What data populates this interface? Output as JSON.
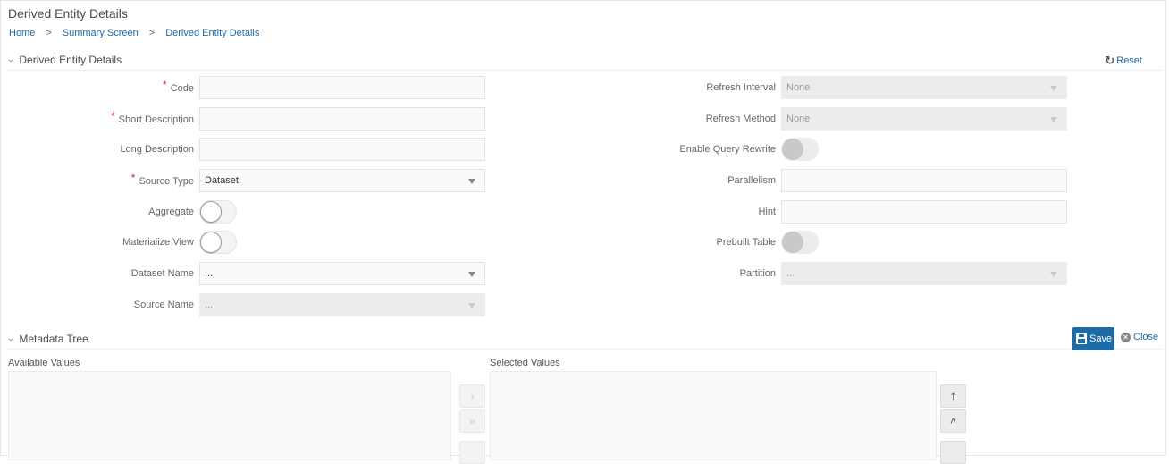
{
  "page": {
    "title": "Derived Entity Details",
    "breadcrumb": [
      "Home",
      "Summary Screen",
      "Derived Entity Details"
    ],
    "breadcrumb_separator": ">"
  },
  "details_section": {
    "title": "Derived Entity Details",
    "reset_label": "Reset",
    "left_fields": [
      {
        "label": "Code",
        "required": true,
        "type": "text",
        "value": ""
      },
      {
        "label": "Short Description",
        "required": true,
        "type": "text",
        "value": ""
      },
      {
        "label": "Long Description",
        "required": false,
        "type": "text",
        "value": ""
      },
      {
        "label": "Source Type",
        "required": true,
        "type": "select",
        "value": "Dataset"
      },
      {
        "label": "Aggregate",
        "required": false,
        "type": "toggle",
        "value": "off"
      },
      {
        "label": "Materialize View",
        "required": false,
        "type": "toggle",
        "value": "off"
      },
      {
        "label": "Dataset Name",
        "required": false,
        "type": "select",
        "value": "..."
      },
      {
        "label": "Source Name",
        "required": false,
        "type": "select",
        "value": "...",
        "disabled": true
      }
    ],
    "right_fields": [
      {
        "label": "Refresh Interval",
        "type": "select",
        "value": "None",
        "disabled": true
      },
      {
        "label": "Refresh Method",
        "type": "select",
        "value": "None",
        "disabled": true
      },
      {
        "label": "Enable Query Rewrite",
        "type": "toggle",
        "value": "off",
        "disabled": true
      },
      {
        "label": "Parallelism",
        "type": "text",
        "value": ""
      },
      {
        "label": "Hint",
        "type": "text",
        "value": ""
      },
      {
        "label": "Prebuilt Table",
        "type": "toggle",
        "value": "off",
        "disabled": true
      },
      {
        "label": "Partition",
        "type": "select",
        "value": "...",
        "disabled": true
      }
    ],
    "required_marker": "*"
  },
  "metadata_section": {
    "title": "Metadata Tree",
    "save_label": "Save",
    "close_label": "Close",
    "available_label": "Available Values",
    "selected_label": "Selected Values",
    "shuttle_buttons": [
      {
        "name": "move-right",
        "glyph": "›"
      },
      {
        "name": "move-all-right",
        "glyph": "»"
      }
    ],
    "order_buttons": [
      {
        "name": "move-top",
        "glyph": "⤒"
      },
      {
        "name": "move-up",
        "glyph": "˄"
      }
    ]
  },
  "colors": {
    "accent": "#1d6aa5",
    "required": "#e0262a",
    "disabled_bg": "#ececec"
  }
}
